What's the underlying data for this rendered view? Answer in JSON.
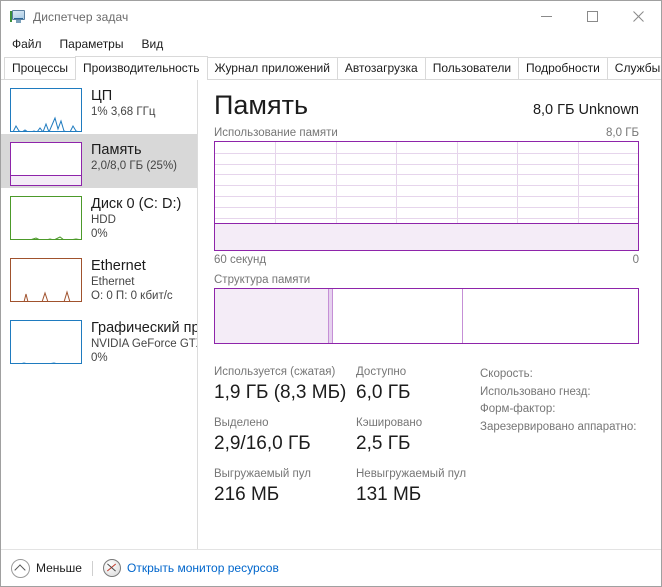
{
  "window": {
    "title": "Диспетчер задач",
    "icon": "task-manager-icon",
    "minimize_label": "—",
    "maximize_label": "□",
    "close_label": "✕"
  },
  "menu": {
    "items": [
      {
        "label": "Файл"
      },
      {
        "label": "Параметры"
      },
      {
        "label": "Вид"
      }
    ]
  },
  "tabs": {
    "active": "Производительность",
    "items": [
      {
        "label": "Процессы",
        "active": false
      },
      {
        "label": "Производительность",
        "active": true
      },
      {
        "label": "Журнал приложений",
        "active": false
      },
      {
        "label": "Автозагрузка",
        "active": false
      },
      {
        "label": "Пользователи",
        "active": false
      },
      {
        "label": "Подробности",
        "active": false
      },
      {
        "label": "Службы",
        "active": false
      }
    ]
  },
  "sidebar": {
    "items": [
      {
        "title": "ЦП",
        "sub1": "1%  3,68 ГГц",
        "sub2": "",
        "color": "#1f7bbf",
        "selected": false,
        "fill": false,
        "spark": "0,44 3,44 6,38 9,43 12,44 15,42 18,44 21,44 24,43 27,44 30,40 33,44 36,36 39,44 42,37 45,30 48,41 51,33 54,43 57,44 60,44 63,38 66,43 69,44 72,44"
      },
      {
        "title": "Память",
        "sub1": "2,0/8,0 ГБ (25%)",
        "sub2": "",
        "color": "#8e24aa",
        "selected": true,
        "fill": true,
        "fill_percent": 25,
        "spark": ""
      },
      {
        "title": "Диск 0 (C: D:)",
        "sub1": "HDD",
        "sub2": "0%",
        "color": "#4c9a2a",
        "selected": false,
        "fill": false,
        "spark": "0,44 12,44 20,44 26,42 30,44 36,44 40,43 44,44 50,41 54,44 60,44 66,43 72,44"
      },
      {
        "title": "Ethernet",
        "sub1": "Ethernet",
        "sub2": "О: 0 П: 0 кбит/с",
        "color": "#a0522d",
        "selected": false,
        "fill": false,
        "spark": "0,44 14,44 16,36 18,44 32,44 35,35 38,44 54,44 57,34 60,44 72,44"
      },
      {
        "title": "Графический пр",
        "sub1": "NVIDIA GeForce GTX",
        "sub2": "0%",
        "color": "#1f7bbf",
        "selected": false,
        "fill": false,
        "spark": "0,44 10,44 14,43 18,44 38,44 44,43 48,44 72,44"
      }
    ]
  },
  "main": {
    "title": "Память",
    "total_spec": "8,0 ГБ Unknown",
    "usage_section": {
      "label": "Использование памяти",
      "max_label": "8,0 ГБ",
      "x_left_label": "60 секунд",
      "x_right_label": "0"
    },
    "composition_section": {
      "label": "Структура памяти"
    },
    "stats": [
      {
        "cells": [
          {
            "label": "Используется (сжатая)",
            "value": "1,9 ГБ (8,3 МБ)"
          },
          {
            "label": "Доступно",
            "value": "6,0 ГБ"
          }
        ]
      },
      {
        "cells": [
          {
            "label": "Выделено",
            "value": "2,9/16,0 ГБ"
          },
          {
            "label": "Кэшировано",
            "value": "2,5 ГБ"
          }
        ]
      },
      {
        "cells": [
          {
            "label": "Выгружаемый пул",
            "value": "216 МБ"
          },
          {
            "label": "Невыгружаемый пул",
            "value": "131 МБ"
          }
        ]
      }
    ],
    "sysinfo": [
      {
        "label": "Скорость:",
        "value": ""
      },
      {
        "label": "Использовано гнезд:",
        "value": ""
      },
      {
        "label": "Форм-фактор:",
        "value": ""
      },
      {
        "label": "Зарезервировано аппаратно:",
        "value": ""
      }
    ]
  },
  "chart_data": {
    "type": "area",
    "title": "Использование памяти",
    "xlabel": "",
    "ylabel": "",
    "x_axis": {
      "left_label": "60 секунд",
      "right_label": "0",
      "range_seconds": 60
    },
    "y_axis": {
      "max_label": "8,0 ГБ",
      "max_value": 8.0,
      "min_value": 0,
      "unit": "ГБ"
    },
    "grid": {
      "horizontal_lines": 10,
      "vertical_lines": 6
    },
    "series": [
      {
        "name": "Использование памяти",
        "color": "#8e24aa",
        "fill_color": "#f4ecf7",
        "constant_value": 2.0,
        "percent_of_max": 25,
        "values": [
          2.0,
          2.0,
          2.0,
          2.0,
          2.0,
          2.0,
          2.0,
          2.0,
          2.0,
          2.0,
          2.0,
          2.0,
          2.0,
          2.0,
          2.0,
          2.0,
          2.0,
          2.0,
          2.0,
          2.0
        ]
      }
    ],
    "composition_bar": {
      "title": "Структура памяти",
      "total_gb": 8.0,
      "segments": [
        {
          "name": "in-use",
          "percent": 26.6,
          "color": "#f4ecf7",
          "border": "#c58fd6"
        },
        {
          "name": "modified",
          "percent": 1.4,
          "color": "#e6d2ef",
          "border": "#c58fd6"
        },
        {
          "name": "standby",
          "percent": 30.6,
          "color": "#ffffff",
          "border": "#c58fd6"
        },
        {
          "name": "free",
          "percent": 41.4,
          "color": "#ffffff",
          "border": "#8e24aa"
        }
      ]
    }
  },
  "footer": {
    "collapse_label": "Меньше",
    "collapse_icon": "chevron-up-circle-icon",
    "resource_monitor_icon": "resource-monitor-icon",
    "resource_monitor_label": "Открыть монитор ресурсов"
  }
}
